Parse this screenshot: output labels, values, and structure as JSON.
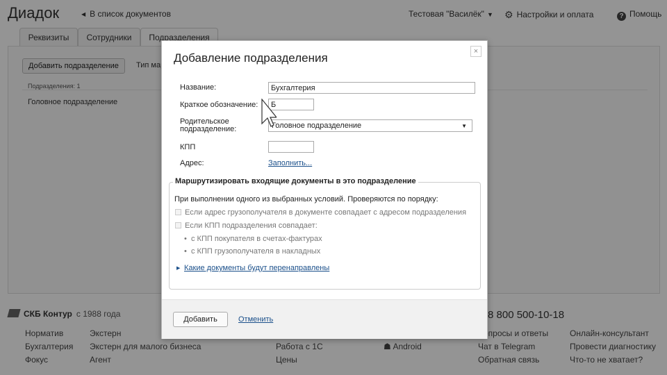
{
  "header": {
    "logo": "Диадок",
    "back_link": "В список документов",
    "org_name": "Тестовая \"Василёк\"",
    "settings": "Настройки и оплата",
    "help": "Помощь"
  },
  "tabs": [
    "Реквизиты",
    "Сотрудники",
    "Подразделения"
  ],
  "content": {
    "add_button": "Добавить подразделение",
    "type_label": "Тип марш",
    "count_label": "Подразделения: 1",
    "row": "Головное подразделение"
  },
  "footer": {
    "brand": "СКБ Контур",
    "since": "с 1988 года",
    "phone": "8 800 500-10-18",
    "col1": [
      "Норматив",
      "Бухгалтерия",
      "Фокус"
    ],
    "col2": [
      "Экстерн",
      "Экстерн для малого бизнеса",
      "Агент"
    ],
    "col3": [
      "Работа с 1С",
      "Цены"
    ],
    "col4": [
      "Android"
    ],
    "col5": [
      "Вопросы и ответы",
      "Чат в Telegram",
      "Обратная связь"
    ],
    "col6": [
      "Онлайн-консультант",
      "Провести диагностику",
      "Что-то не хватает?"
    ]
  },
  "modal": {
    "title": "Добавление подразделения",
    "close": "×",
    "name_label": "Название:",
    "name_value": "Бухгалтерия",
    "short_label": "Краткое обозначение:",
    "short_value": "Б",
    "parent_label_1": "Родительское",
    "parent_label_2": "подразделение:",
    "parent_value": "Головное подразделение",
    "kpp_label": "КПП",
    "kpp_value": "",
    "address_label": "Адрес:",
    "address_link": "Заполнить...",
    "route_title": "Маршрутизировать входящие документы в это подразделение",
    "route_sub": "При выполнении одного из выбранных условий. Проверяются по порядку:",
    "option1": "Если адрес грузополучателя в документе совпадает с адресом подразделения",
    "option2": "Если КПП подразделения совпадает:",
    "bullet1": "с КПП покупателя в счетах-фактурах",
    "bullet2": "с КПП грузополучателя в накладных",
    "docs_link": "Какие документы будут перенаправлены",
    "submit": "Добавить",
    "cancel": "Отменить"
  }
}
